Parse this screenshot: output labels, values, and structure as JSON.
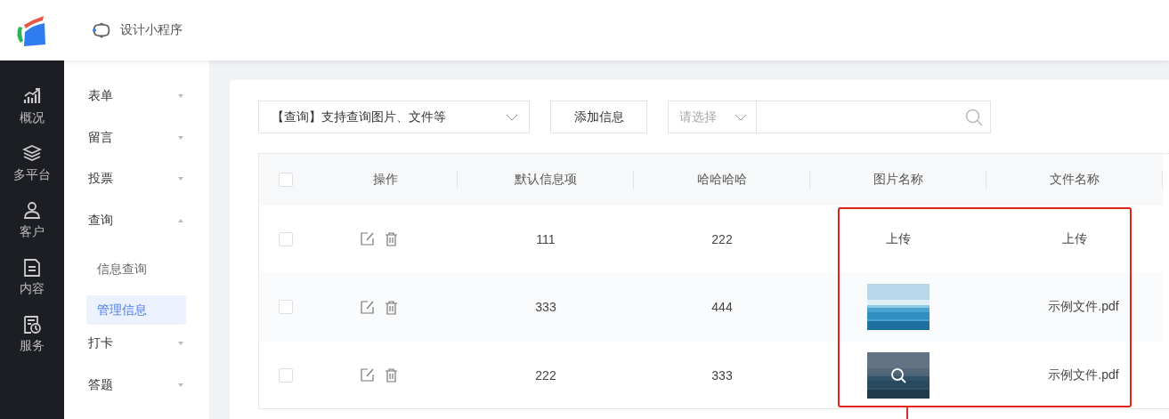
{
  "header": {
    "title": "设计小程序"
  },
  "rail": [
    {
      "label": "概况",
      "kind": "chart"
    },
    {
      "label": "多平台",
      "kind": "layers"
    },
    {
      "label": "客户",
      "kind": "user"
    },
    {
      "label": "内容",
      "kind": "document"
    },
    {
      "label": "服务",
      "kind": "service"
    }
  ],
  "menu": [
    {
      "label": "表单",
      "expanded": false
    },
    {
      "label": "留言",
      "expanded": false
    },
    {
      "label": "投票",
      "expanded": false
    },
    {
      "label": "查询",
      "expanded": true,
      "children": [
        {
          "label": "信息查询",
          "selected": false
        },
        {
          "label": "管理信息",
          "selected": true
        }
      ]
    },
    {
      "label": "打卡",
      "expanded": false
    },
    {
      "label": "答题",
      "expanded": false
    }
  ],
  "toolbar": {
    "query_select": {
      "value": "【查询】支持查询图片、文件等"
    },
    "add_button": "添加信息",
    "filter_select": {
      "placeholder": "请选择"
    }
  },
  "table": {
    "select_all": {
      "checked": false
    },
    "columns": [
      "操作",
      "默认信息项",
      "哈哈哈哈",
      "图片名称",
      "文件名称"
    ],
    "rows": [
      {
        "checked": false,
        "default_item": "111",
        "hahaha": "222",
        "picture": {
          "kind": "link",
          "text": "上传"
        },
        "file": {
          "kind": "link",
          "text": "上传"
        }
      },
      {
        "checked": false,
        "default_item": "333",
        "hahaha": "444",
        "picture": {
          "kind": "picture",
          "hovered": false
        },
        "file": {
          "kind": "text",
          "text": "示例文件.pdf"
        }
      },
      {
        "checked": false,
        "default_item": "222",
        "hahaha": "333",
        "picture": {
          "kind": "picture",
          "hovered": true
        },
        "file": {
          "kind": "text",
          "text": "示例文件.pdf"
        }
      }
    ]
  }
}
